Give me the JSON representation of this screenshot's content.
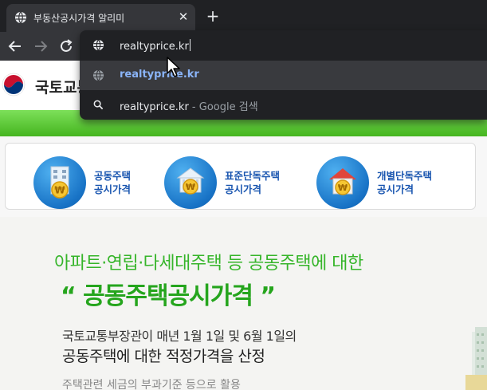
{
  "tab": {
    "title": "부동산공시가격 알리미",
    "close_glyph": "✕"
  },
  "new_tab_glyph": "+",
  "omnibox": {
    "input_value": "realtyprice.kr",
    "suggestions": [
      {
        "text": "realtyprice.kr",
        "icon": "globe-icon"
      },
      {
        "text": "realtyprice.kr",
        "suffix": " - Google 검색",
        "icon": "search-icon"
      }
    ]
  },
  "site": {
    "name": "국토교통"
  },
  "categories": [
    {
      "line1": "공동주택",
      "line2": "공시가격",
      "icon": "apartment-icon"
    },
    {
      "line1": "표준단독주택",
      "line2": "공시가격",
      "icon": "standard-house-icon"
    },
    {
      "line1": "개별단독주택",
      "line2": "공시가격",
      "icon": "individual-house-icon"
    }
  ],
  "banner": {
    "headline_top": "아파트·연립·다세대주택 등 공동주택에 대한",
    "headline_main": "“ 공동주택공시가격 ”",
    "desc_1": "국토교통부장관이 매년 1월 1일 및 6월 1일의",
    "desc_2": "공동주택에 대한 적정가격을 산정",
    "desc_3": "주택관련 세금의 부과기준 등으로 활용"
  },
  "colors": {
    "accent_green": "#25a51d",
    "link_blue": "#8ab4f8",
    "chrome_dark": "#202124",
    "icon_blue": "#1873c6"
  }
}
